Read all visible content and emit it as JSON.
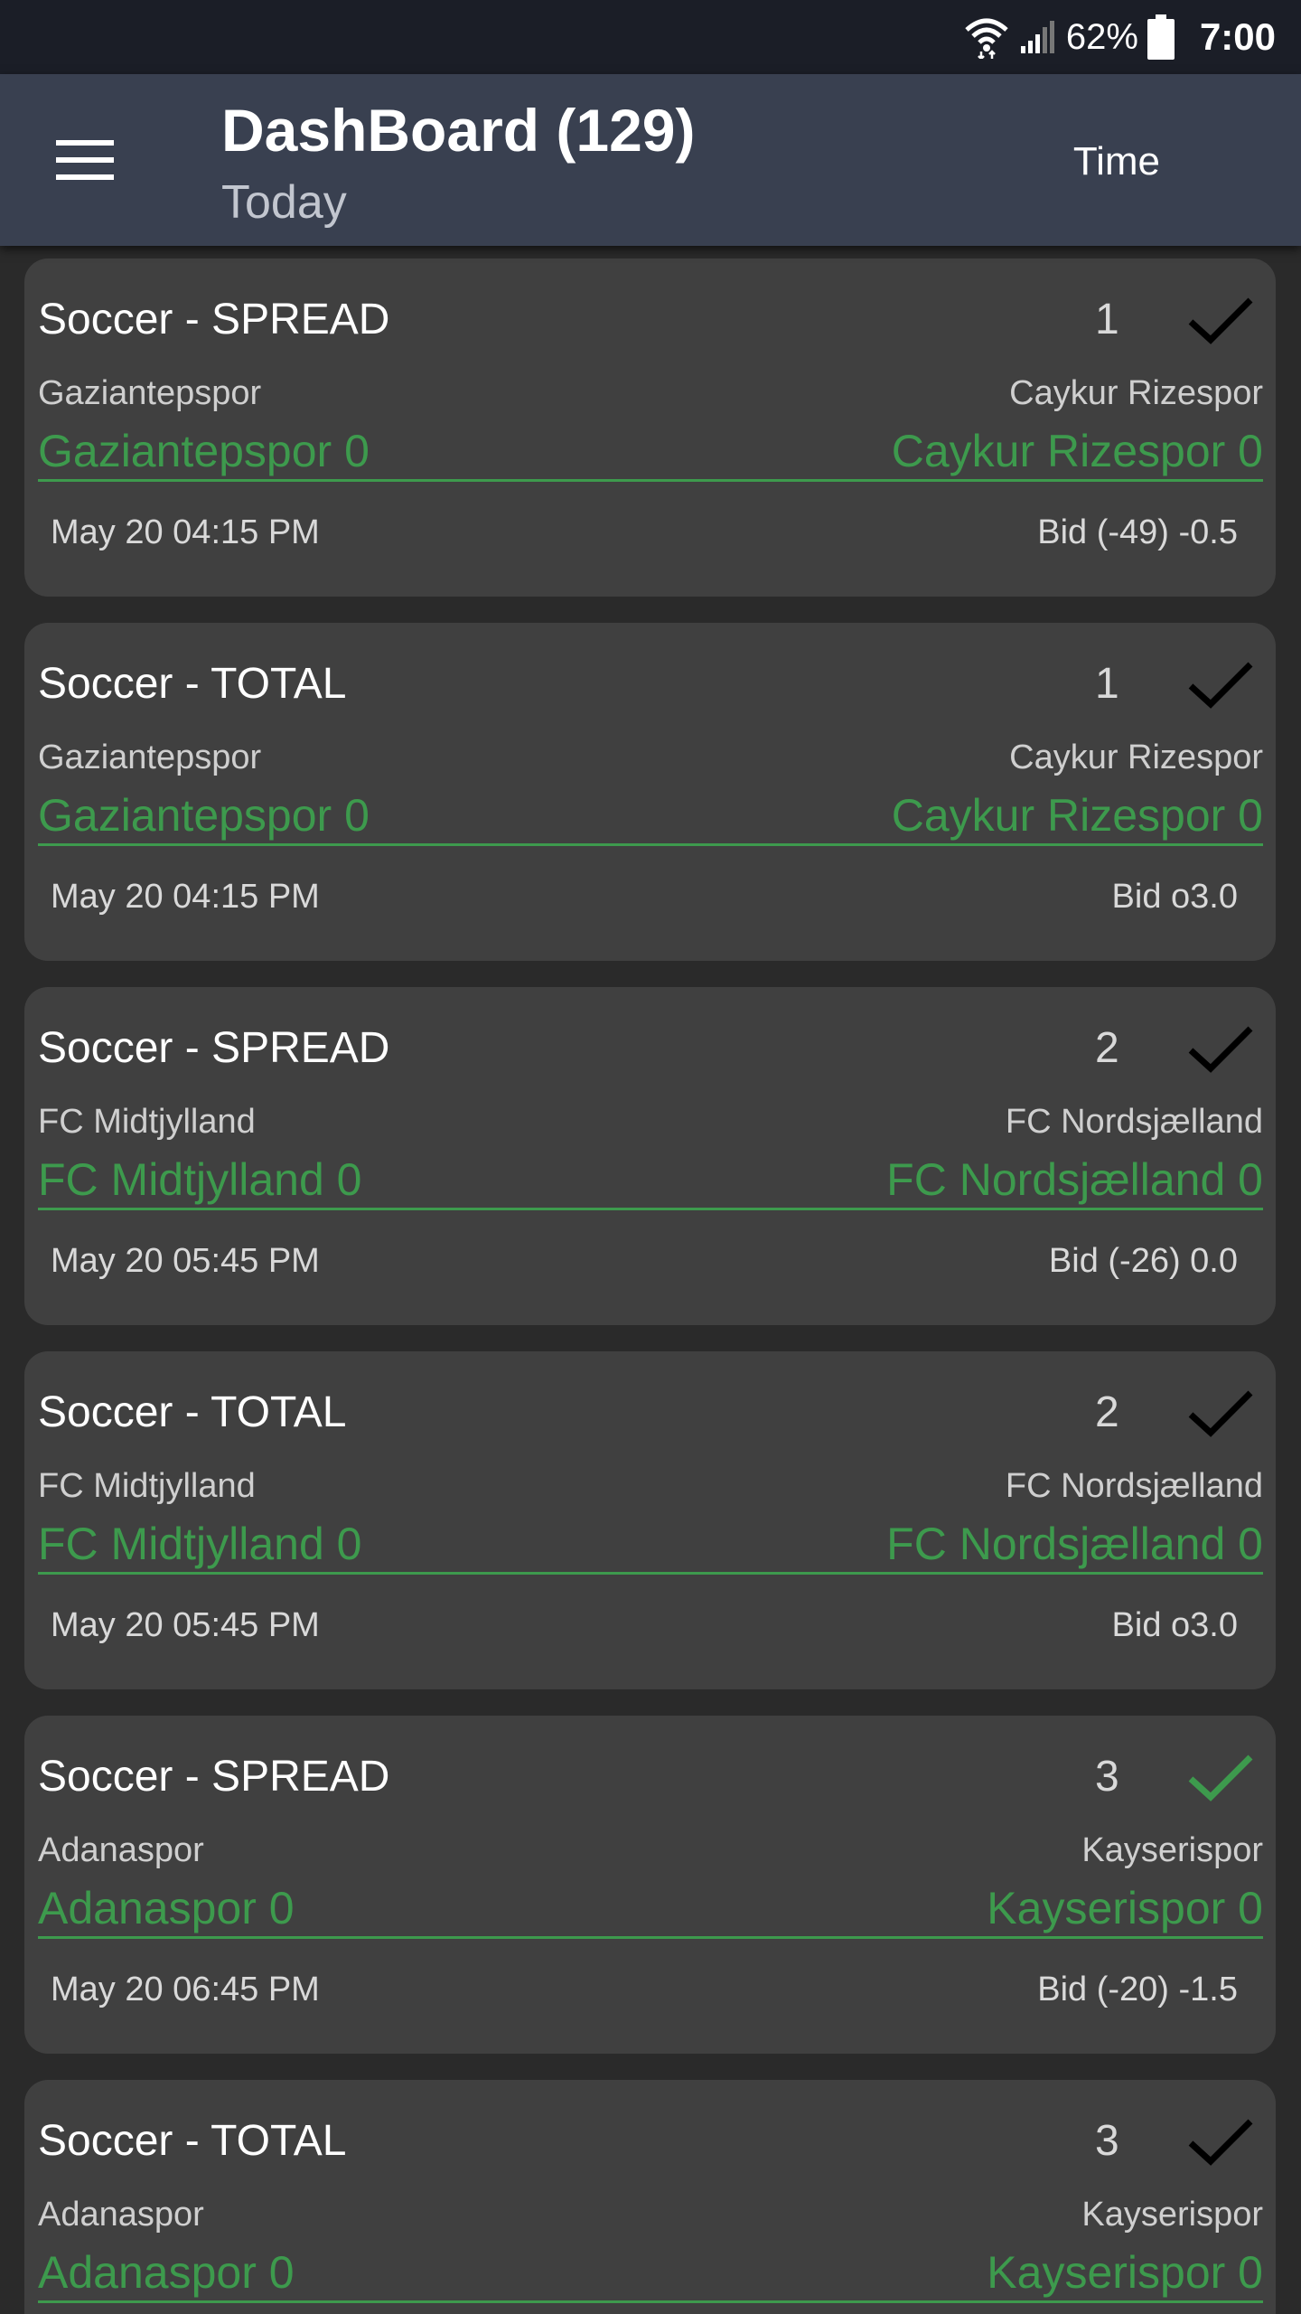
{
  "status_bar": {
    "battery_percent": "62%",
    "time": "7:00"
  },
  "header": {
    "title": "DashBoard (129)",
    "subtitle": "Today",
    "action_label": "Time"
  },
  "colors": {
    "accent_green": "#3d9a4d",
    "check_default": "#000000",
    "check_highlight": "#3d9a4d"
  },
  "cards": [
    {
      "sport_market": "Soccer - SPREAD",
      "number": "1",
      "check_color": "#000000",
      "home_team": "Gaziantepspor",
      "away_team": "Caykur Rizespor",
      "home_score": "Gaziantepspor 0",
      "away_score": "Caykur Rizespor 0",
      "datetime": "May 20  04:15 PM",
      "bid": "Bid (-49) -0.5"
    },
    {
      "sport_market": "Soccer - TOTAL",
      "number": "1",
      "check_color": "#000000",
      "home_team": "Gaziantepspor",
      "away_team": "Caykur Rizespor",
      "home_score": "Gaziantepspor 0",
      "away_score": "Caykur Rizespor 0",
      "datetime": "May 20  04:15 PM",
      "bid": "Bid o3.0"
    },
    {
      "sport_market": "Soccer - SPREAD",
      "number": "2",
      "check_color": "#000000",
      "home_team": "FC Midtjylland",
      "away_team": "FC Nordsjælland",
      "home_score": "FC Midtjylland 0",
      "away_score": "FC Nordsjælland 0",
      "datetime": "May 20  05:45 PM",
      "bid": "Bid (-26) 0.0"
    },
    {
      "sport_market": "Soccer - TOTAL",
      "number": "2",
      "check_color": "#000000",
      "home_team": "FC Midtjylland",
      "away_team": "FC Nordsjælland",
      "home_score": "FC Midtjylland 0",
      "away_score": "FC Nordsjælland 0",
      "datetime": "May 20  05:45 PM",
      "bid": "Bid o3.0"
    },
    {
      "sport_market": "Soccer - SPREAD",
      "number": "3",
      "check_color": "#3d9a4d",
      "home_team": "Adanaspor",
      "away_team": "Kayserispor",
      "home_score": "Adanaspor 0",
      "away_score": "Kayserispor 0",
      "datetime": "May 20  06:45 PM",
      "bid": "Bid (-20) -1.5"
    },
    {
      "sport_market": "Soccer - TOTAL",
      "number": "3",
      "check_color": "#000000",
      "home_team": "Adanaspor",
      "away_team": "Kayserispor",
      "home_score": "Adanaspor 0",
      "away_score": "Kayserispor 0",
      "datetime": "",
      "bid": ""
    }
  ]
}
